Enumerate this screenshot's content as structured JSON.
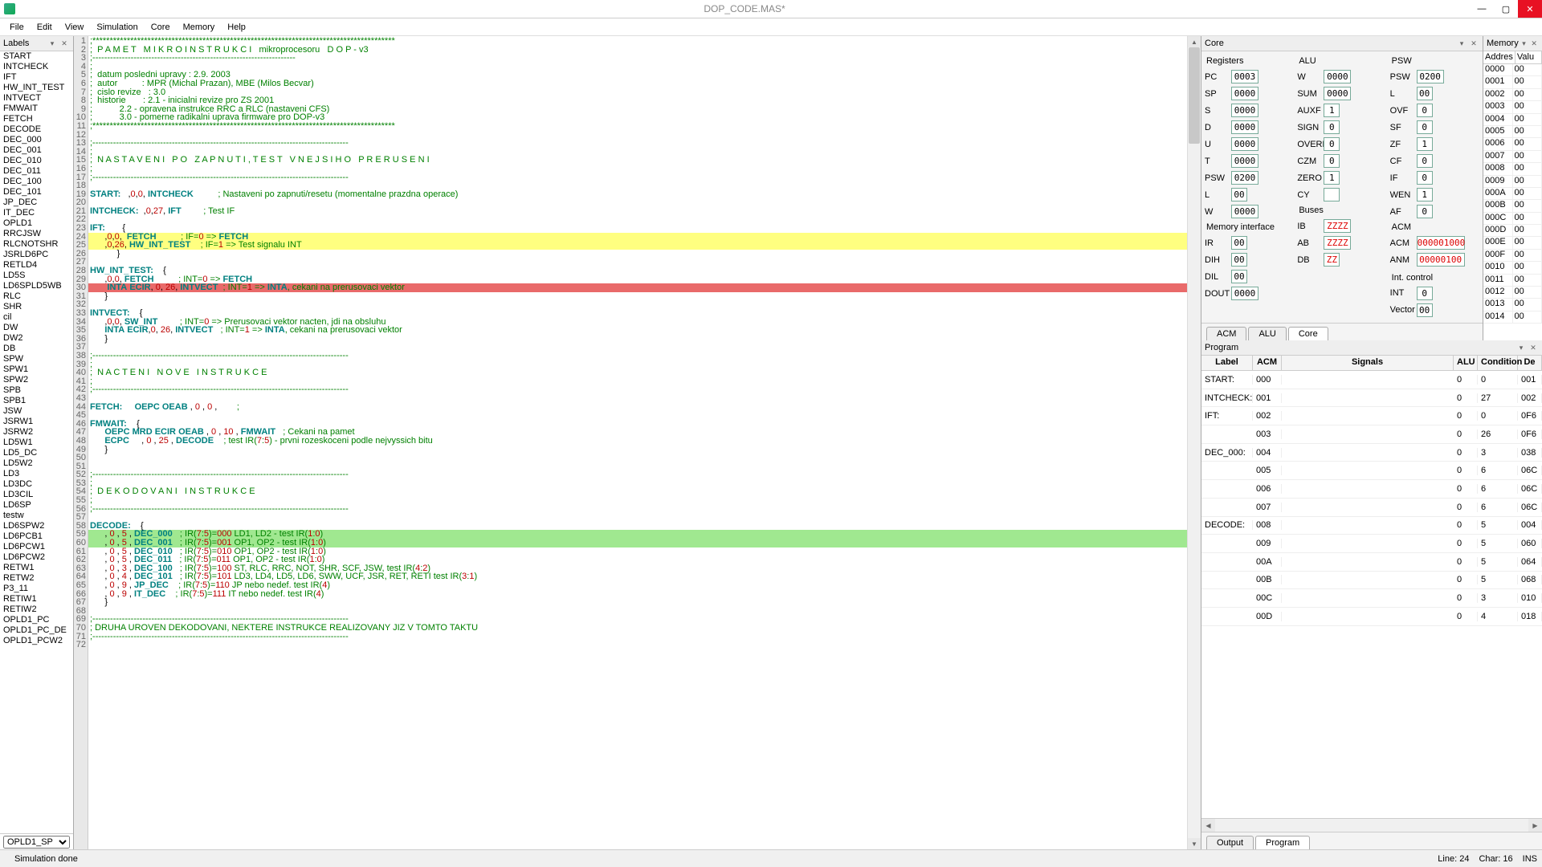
{
  "title": "DOP_CODE.MAS*",
  "menu": [
    "File",
    "Edit",
    "View",
    "Simulation",
    "Core",
    "Memory",
    "Help"
  ],
  "labels_panel": {
    "title": "Labels",
    "items": [
      "START",
      "INTCHECK",
      "IFT",
      "HW_INT_TEST",
      "INTVECT",
      "FMWAIT",
      "FETCH",
      "DECODE",
      "DEC_000",
      "DEC_001",
      "DEC_010",
      "DEC_011",
      "DEC_100",
      "DEC_101",
      "JP_DEC",
      "IT_DEC",
      "OPLD1",
      "RRCJSW",
      "RLCNOTSHR",
      "JSRLD6PC",
      "RETLD4",
      "LD5S",
      "LD6SPLD5WB",
      "RLC",
      "SHR",
      "cil",
      "DW",
      "DW2",
      "DB",
      "SPW",
      "SPW1",
      "SPW2",
      "SPB",
      "SPB1",
      "JSW",
      "JSRW1",
      "JSRW2",
      "LD5W1",
      "LD5_DC",
      "LD5W2",
      "LD3",
      "LD3DC",
      "LD3CIL",
      "LD6SP",
      "testw",
      "LD6SPW2",
      "LD6PCB1",
      "LD6PCW1",
      "LD6PCW2",
      "RETW1",
      "RETW2",
      "P3_11",
      "RETIW1",
      "RETIW2",
      "OPLD1_PC",
      "OPLD1_PC_DE",
      "OPLD1_PCW2"
    ],
    "dropdown": "OPLD1_SP"
  },
  "code": [
    {
      "n": 1,
      "t": ";****************************************************************************************",
      "c": "cmt"
    },
    {
      "n": 2,
      "t": ";  P A M E T   M I K R O I N S T R U K C I   mikroprocesoru   D O P - v3",
      "c": "cmt"
    },
    {
      "n": 3,
      "t": ";---------------------------------------------------------------------",
      "c": "cmt"
    },
    {
      "n": 4,
      "t": ";",
      "c": "cmt"
    },
    {
      "n": 5,
      "t": ";  datum posledni upravy : 2.9. 2003",
      "c": "cmt"
    },
    {
      "n": 6,
      "t": ";  autor          : MPR (Michal Prazan), MBE (Milos Becvar)",
      "c": "cmt"
    },
    {
      "n": 7,
      "t": ";  cislo revize   : 3.0",
      "c": "cmt"
    },
    {
      "n": 8,
      "t": ";  historie       : 2.1 - inicialni revize pro ZS 2001",
      "c": "cmt"
    },
    {
      "n": 9,
      "t": ";           2.2 - opravena instrukce RRC a RLC (nastaveni CFS)",
      "c": "cmt"
    },
    {
      "n": 10,
      "t": ";           3.0 - pomerne radikalni uprava firmware pro DOP-v3",
      "c": "cmt"
    },
    {
      "n": 11,
      "t": ";****************************************************************************************",
      "c": "cmt"
    },
    {
      "n": 12,
      "t": ""
    },
    {
      "n": 13,
      "t": ";---------------------------------------------------------------------------------------",
      "c": "cmt"
    },
    {
      "n": 14,
      "t": ";",
      "c": "cmt"
    },
    {
      "n": 15,
      "t": ";  N A S T A V E N I   P O   Z A P N U T I , T E S T   V N E J S I H O   P R E R U S E N I",
      "c": "cmt"
    },
    {
      "n": 16,
      "t": ";",
      "c": "cmt"
    },
    {
      "n": 17,
      "t": ";---------------------------------------------------------------------------------------",
      "c": "cmt"
    },
    {
      "n": 18,
      "t": ""
    },
    {
      "n": 19,
      "t": "START:   ,0,0, INTCHECK          ; Nastaveni po zapnuti/resetu (momentalne prazdna operace)"
    },
    {
      "n": 20,
      "t": ""
    },
    {
      "n": 21,
      "t": "INTCHECK:  ,0,27, IFT         ; Test IF"
    },
    {
      "n": 22,
      "t": ""
    },
    {
      "n": 23,
      "t": "IFT:       {"
    },
    {
      "n": 24,
      "t": "      ,0,0,  FETCH          ; IF=0 => FETCH",
      "hl": "yellow"
    },
    {
      "n": 25,
      "t": "      ,0,26, HW_INT_TEST    ; IF=1 => Test signalu INT",
      "hl": "yellow"
    },
    {
      "n": 26,
      "t": "           }"
    },
    {
      "n": 27,
      "t": ""
    },
    {
      "n": 28,
      "t": "HW_INT_TEST:    {"
    },
    {
      "n": 29,
      "t": "      ,0,0, FETCH          ; INT=0 => FETCH"
    },
    {
      "n": 30,
      "t": "       INTA ECIR, 0, 26, INTVECT  ; INT=1 => INTA, cekani na prerusovaci vektor",
      "hl": "red"
    },
    {
      "n": 31,
      "t": "      }"
    },
    {
      "n": 32,
      "t": ""
    },
    {
      "n": 33,
      "t": "INTVECT:    {"
    },
    {
      "n": 34,
      "t": "      ,0,0, SW_INT         ; INT=0 => Prerusovaci vektor nacten, jdi na obsluhu"
    },
    {
      "n": 35,
      "t": "      INTA ECIR,0, 26, INTVECT   ; INT=1 => INTA, cekani na prerusovaci vektor"
    },
    {
      "n": 36,
      "t": "      }"
    },
    {
      "n": 37,
      "t": ""
    },
    {
      "n": 38,
      "t": ";---------------------------------------------------------------------------------------",
      "c": "cmt"
    },
    {
      "n": 39,
      "t": ";",
      "c": "cmt"
    },
    {
      "n": 40,
      "t": ";  N A C T E N I   N O V E   I N S T R U K C E",
      "c": "cmt"
    },
    {
      "n": 41,
      "t": ";",
      "c": "cmt"
    },
    {
      "n": 42,
      "t": ";---------------------------------------------------------------------------------------",
      "c": "cmt"
    },
    {
      "n": 43,
      "t": ""
    },
    {
      "n": 44,
      "t": "FETCH:     OEPC OEAB , 0 , 0 ,        ;"
    },
    {
      "n": 45,
      "t": ""
    },
    {
      "n": 46,
      "t": "FMWAIT:    {"
    },
    {
      "n": 47,
      "t": "      OEPC MRD ECIR OEAB , 0 , 10 , FMWAIT   ; Cekani na pamet"
    },
    {
      "n": 48,
      "t": "      ECPC     , 0 , 25 , DECODE    ; test IR(7:5) - prvni rozeskoceni podle nejvyssich bitu"
    },
    {
      "n": 49,
      "t": "      }"
    },
    {
      "n": 50,
      "t": ""
    },
    {
      "n": 51,
      "t": ""
    },
    {
      "n": 52,
      "t": ";---------------------------------------------------------------------------------------",
      "c": "cmt"
    },
    {
      "n": 53,
      "t": ";",
      "c": "cmt"
    },
    {
      "n": 54,
      "t": ";  D E K O D O V A N I   I N S T R U K C E",
      "c": "cmt"
    },
    {
      "n": 55,
      "t": ";",
      "c": "cmt"
    },
    {
      "n": 56,
      "t": ";---------------------------------------------------------------------------------------",
      "c": "cmt"
    },
    {
      "n": 57,
      "t": ""
    },
    {
      "n": 58,
      "t": "DECODE:    {"
    },
    {
      "n": 59,
      "t": "      , 0 , 5 , DEC_000   ; IR(7:5)=000 LD1, LD2 - test IR(1:0)",
      "hl": "green"
    },
    {
      "n": 60,
      "t": "      , 0 , 5 , DEC_001   ; IR(7:5)=001 OP1, OP2 - test IR(1:0)",
      "hl": "green"
    },
    {
      "n": 61,
      "t": "      , 0 , 5 , DEC_010   ; IR(7:5)=010 OP1, OP2 - test IR(1:0)"
    },
    {
      "n": 62,
      "t": "      , 0 , 5 , DEC_011   ; IR(7:5)=011 OP1, OP2 - test IR(1:0)"
    },
    {
      "n": 63,
      "t": "      , 0 , 3 , DEC_100   ; IR(7:5)=100 ST, RLC, RRC, NOT, SHR, SCF, JSW, test IR(4:2)"
    },
    {
      "n": 64,
      "t": "      , 0 , 4 , DEC_101   ; IR(7:5)=101 LD3, LD4, LD5, LD6, SWW, UCF, JSR, RET, RETI test IR(3:1)"
    },
    {
      "n": 65,
      "t": "      , 0 , 9 , JP_DEC    ; IR(7:5)=110 JP nebo nedef. test IR(4)"
    },
    {
      "n": 66,
      "t": "      , 0 , 9 , IT_DEC    ; IR(7:5)=111 IT nebo nedef. test IR(4)"
    },
    {
      "n": 67,
      "t": "      }"
    },
    {
      "n": 68,
      "t": ""
    },
    {
      "n": 69,
      "t": ";---------------------------------------------------------------------------------------",
      "c": "cmt"
    },
    {
      "n": 70,
      "t": "; DRUHA UROVEN DEKODOVANI, NEKTERE INSTRUKCE REALIZOVANY JIZ V TOMTO TAKTU",
      "c": "cmt"
    },
    {
      "n": 71,
      "t": ";---------------------------------------------------------------------------------------",
      "c": "cmt"
    },
    {
      "n": 72,
      "t": ""
    }
  ],
  "core": {
    "title": "Core",
    "registers_title": "Registers",
    "alu_title": "ALU",
    "psw_title": "PSW",
    "mem_if_title": "Memory interface",
    "buses_title": "Buses",
    "acm_title": "ACM",
    "int_title": "Int. control",
    "registers": [
      {
        "k": "PC",
        "v": "0003"
      },
      {
        "k": "SP",
        "v": "0000"
      },
      {
        "k": "S",
        "v": "0000"
      },
      {
        "k": "D",
        "v": "0000"
      },
      {
        "k": "U",
        "v": "0000"
      },
      {
        "k": "T",
        "v": "0000"
      },
      {
        "k": "PSW",
        "v": "0200"
      },
      {
        "k": "L",
        "v": "00"
      },
      {
        "k": "W",
        "v": "0000"
      }
    ],
    "alu": [
      {
        "k": "W",
        "v": "0000"
      },
      {
        "k": "SUM",
        "v": "0000"
      },
      {
        "k": "AUXF",
        "v": "1"
      },
      {
        "k": "SIGN",
        "v": "0"
      },
      {
        "k": "OVERF",
        "v": "0"
      },
      {
        "k": "CZM",
        "v": "0"
      },
      {
        "k": "ZERO",
        "v": "1"
      },
      {
        "k": "CY",
        "v": ""
      }
    ],
    "psw": [
      {
        "k": "PSW",
        "v": "0200"
      },
      {
        "k": "L",
        "v": "00"
      },
      {
        "k": "OVF",
        "v": "0"
      },
      {
        "k": "SF",
        "v": "0"
      },
      {
        "k": "ZF",
        "v": "1"
      },
      {
        "k": "CF",
        "v": "0"
      },
      {
        "k": "IF",
        "v": "0"
      },
      {
        "k": "WEN",
        "v": "1"
      },
      {
        "k": "AF",
        "v": "0"
      }
    ],
    "mem_if": [
      {
        "k": "IR",
        "v": "00"
      },
      {
        "k": "DIH",
        "v": "00"
      },
      {
        "k": "DIL",
        "v": "00"
      },
      {
        "k": "DOUT",
        "v": "0000"
      }
    ],
    "buses": [
      {
        "k": "IB",
        "v": "ZZZZ",
        "ch": true
      },
      {
        "k": "AB",
        "v": "ZZZZ",
        "ch": true
      },
      {
        "k": "DB",
        "v": "ZZ",
        "ch": true
      }
    ],
    "acm": [
      {
        "k": "ACM",
        "v": "000001000",
        "ch": true
      },
      {
        "k": "ANM",
        "v": "00000100",
        "ch": true
      }
    ],
    "int": [
      {
        "k": "INT",
        "v": "0"
      },
      {
        "k": "Vector",
        "v": "00"
      }
    ],
    "tabs": [
      "ACM",
      "ALU",
      "Core"
    ],
    "active_tab": "Core"
  },
  "memory": {
    "title": "Memory",
    "cols": [
      "Addres",
      "Valu"
    ],
    "rows": [
      [
        "0000",
        "00"
      ],
      [
        "0001",
        "00"
      ],
      [
        "0002",
        "00"
      ],
      [
        "0003",
        "00"
      ],
      [
        "0004",
        "00"
      ],
      [
        "0005",
        "00"
      ],
      [
        "0006",
        "00"
      ],
      [
        "0007",
        "00"
      ],
      [
        "0008",
        "00"
      ],
      [
        "0009",
        "00"
      ],
      [
        "000A",
        "00"
      ],
      [
        "000B",
        "00"
      ],
      [
        "000C",
        "00"
      ],
      [
        "000D",
        "00"
      ],
      [
        "000E",
        "00"
      ],
      [
        "000F",
        "00"
      ],
      [
        "0010",
        "00"
      ],
      [
        "0011",
        "00"
      ],
      [
        "0012",
        "00"
      ],
      [
        "0013",
        "00"
      ],
      [
        "0014",
        "00"
      ]
    ]
  },
  "program": {
    "title": "Program",
    "cols": [
      "Label",
      "ACM",
      "Signals",
      "ALU",
      "Condition",
      "De"
    ],
    "rows": [
      {
        "label": "START:",
        "acm": "000",
        "sig": "",
        "alu": "0",
        "cond": "0",
        "de": "001"
      },
      {
        "label": "INTCHECK:",
        "acm": "001",
        "sig": "",
        "alu": "0",
        "cond": "27",
        "de": "002"
      },
      {
        "label": "IFT:",
        "acm": "002",
        "sig": "",
        "alu": "0",
        "cond": "0",
        "de": "0F6"
      },
      {
        "label": "",
        "acm": "003",
        "sig": "",
        "alu": "0",
        "cond": "26",
        "de": "0F6"
      },
      {
        "label": "DEC_000:",
        "acm": "004",
        "sig": "",
        "alu": "0",
        "cond": "3",
        "de": "038"
      },
      {
        "label": "",
        "acm": "005",
        "sig": "",
        "alu": "0",
        "cond": "6",
        "de": "06C"
      },
      {
        "label": "",
        "acm": "006",
        "sig": "",
        "alu": "0",
        "cond": "6",
        "de": "06C"
      },
      {
        "label": "",
        "acm": "007",
        "sig": "",
        "alu": "0",
        "cond": "6",
        "de": "06C"
      },
      {
        "label": "DECODE:",
        "acm": "008",
        "sig": "",
        "alu": "0",
        "cond": "5",
        "de": "004"
      },
      {
        "label": "",
        "acm": "009",
        "sig": "",
        "alu": "0",
        "cond": "5",
        "de": "060"
      },
      {
        "label": "",
        "acm": "00A",
        "sig": "",
        "alu": "0",
        "cond": "5",
        "de": "064"
      },
      {
        "label": "",
        "acm": "00B",
        "sig": "",
        "alu": "0",
        "cond": "5",
        "de": "068"
      },
      {
        "label": "",
        "acm": "00C",
        "sig": "",
        "alu": "0",
        "cond": "3",
        "de": "010"
      },
      {
        "label": "",
        "acm": "00D",
        "sig": "",
        "alu": "0",
        "cond": "4",
        "de": "018"
      }
    ],
    "tabs": [
      "Output",
      "Program"
    ],
    "active_tab": "Program"
  },
  "status": {
    "msg": "Simulation done",
    "line": "Line: 24",
    "char": "Char: 16",
    "ins": "INS"
  }
}
